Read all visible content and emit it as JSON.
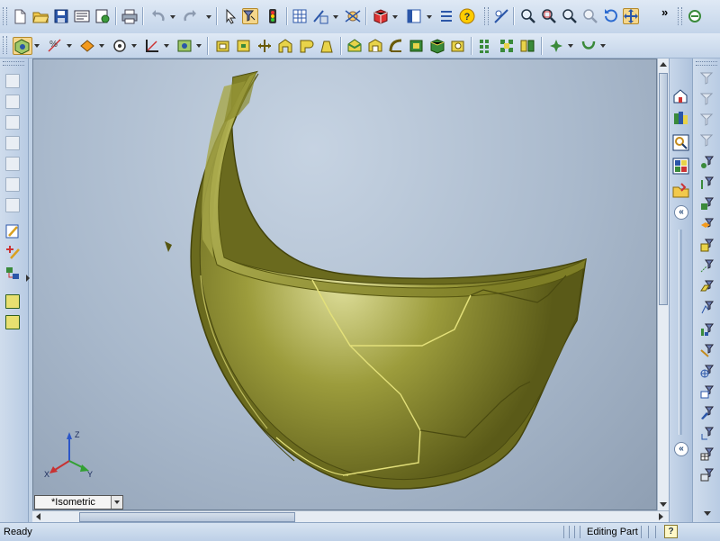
{
  "view": {
    "orientation_label": "*Isometric",
    "triad_labels": {
      "x": "X",
      "y": "Y",
      "z": "Z"
    }
  },
  "status_bar": {
    "ready_text": "Ready",
    "mode_text": "Editing Part",
    "help_glyph": "?"
  },
  "task_pane": {
    "collapse_glyph": "«"
  },
  "toolbar": {
    "overflow_glyph": "»"
  },
  "colors": {
    "part_fill": "#9a9a32",
    "part_edge": "#4e4e10",
    "viewport_bg": "#a9b9cc",
    "toolbar_bg": "#c3d4e9"
  },
  "icons": {
    "standard": [
      "new-document-icon",
      "open-folder-icon",
      "save-icon",
      "print-icon",
      "options-icon",
      "undo-icon",
      "redo-icon",
      "select-icon",
      "rebuild-icon",
      "traffic-light-icon"
    ],
    "view": [
      "grid-icon",
      "sketch-icon",
      "smart-dimension-icon",
      "3d-box-icon",
      "section-view-icon",
      "help-icon",
      "zoom-to-fit-icon",
      "zoom-area-icon",
      "zoom-in-out-icon",
      "zoom-selection-icon",
      "rotate-view-icon",
      "pan-icon"
    ]
  }
}
